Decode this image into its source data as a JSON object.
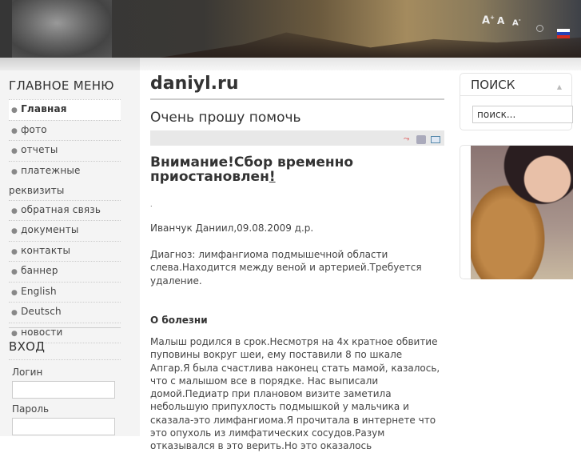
{
  "header": {
    "font_larger": "A",
    "font_reset": "A",
    "font_smaller": "A",
    "icons": [
      "search-icon",
      "russian-flag-icon"
    ]
  },
  "left": {
    "menu_title": "ГЛАВНОЕ МЕНЮ",
    "menu": [
      {
        "label": "Главная",
        "active": true
      },
      {
        "label": "фото"
      },
      {
        "label": "отчеты"
      },
      {
        "label": "платежные реквизиты"
      },
      {
        "label": "обратная связь"
      },
      {
        "label": "документы"
      },
      {
        "label": "контакты"
      },
      {
        "label": "баннер"
      },
      {
        "label": "English"
      },
      {
        "label": "Deutsch"
      },
      {
        "label": "новости"
      }
    ],
    "login_title": "ВХОД",
    "login_label": "Логин",
    "password_label": "Пароль"
  },
  "main": {
    "site_title": "daniyl.ru",
    "article_title": "Очень прошу помочь",
    "tools": [
      "pdf-icon",
      "print-icon",
      "email-icon"
    ],
    "heading": "Внимание!Сбор временно приостановлен",
    "heading_link": "!",
    "dot": ".",
    "name_line": "Иванчук Даниил,09.08.2009 д.р.",
    "diagnosis": "Диагноз: лимфангиома подмышечной области слева.Находится между веной и артерией.Требуется удаление.",
    "section": "О болезни",
    "story": "Малыш родился в срок.Несмотря на 4х кратное обвитие пуповины вокруг шеи, ему поставили 8 по шкале Апгар.Я была счастлива наконец стать мамой, казалось, что с малышом все в порядке. Нас выписали домой.Педиатр при плановом визите заметила небольшую припухлость подмышкой у мальчика и сказала-это лимфангиома.Я прочитала в интернете что это опухоль из лимфатических сосудов.Разум отказывался в это верить.Но это оказалось"
  },
  "right": {
    "search_title": "ПОИСК",
    "search_value": "поиск..."
  }
}
